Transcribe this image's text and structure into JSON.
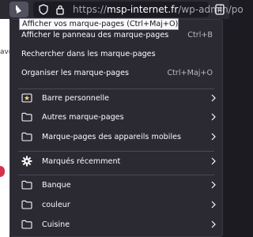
{
  "toolbar": {
    "url_host": "msp-internet.fr",
    "url_path": "/wp-admin/po",
    "url_prefix": "https://",
    "icons": [
      "bookmarks-menu-icon",
      "shield-icon",
      "lock-icon",
      "reader-mode-icon"
    ]
  },
  "tooltip": "Afficher vos marque-pages (Ctrl+Maj+O)",
  "page": {
    "partial_label": "avo"
  },
  "menu": {
    "actions": [
      {
        "label": "Afficher le panneau des marque-pages",
        "shortcut": "Ctrl+B"
      },
      {
        "label": "Rechercher dans les marque-pages",
        "shortcut": ""
      },
      {
        "label": "Organiser les marque-pages",
        "shortcut": "Ctrl+Maj+O"
      }
    ],
    "folders_top": [
      {
        "label": "Barre personnelle",
        "icon": "star-folder-icon"
      },
      {
        "label": "Autres marque-pages",
        "icon": "folder-icon"
      },
      {
        "label": "Marque-pages des appareils mobiles",
        "icon": "folder-icon"
      }
    ],
    "recent": {
      "label": "Marqués récemment",
      "icon": "gear-icon"
    },
    "folders_bottom": [
      {
        "label": "Banque",
        "icon": "folder-icon"
      },
      {
        "label": "couleur",
        "icon": "folder-icon"
      },
      {
        "label": "Cuisine",
        "icon": "folder-icon"
      }
    ]
  },
  "colors": {
    "panel_bg": "#2b2a33",
    "text": "#fbfbfe",
    "accent_star": "#ffd567"
  }
}
